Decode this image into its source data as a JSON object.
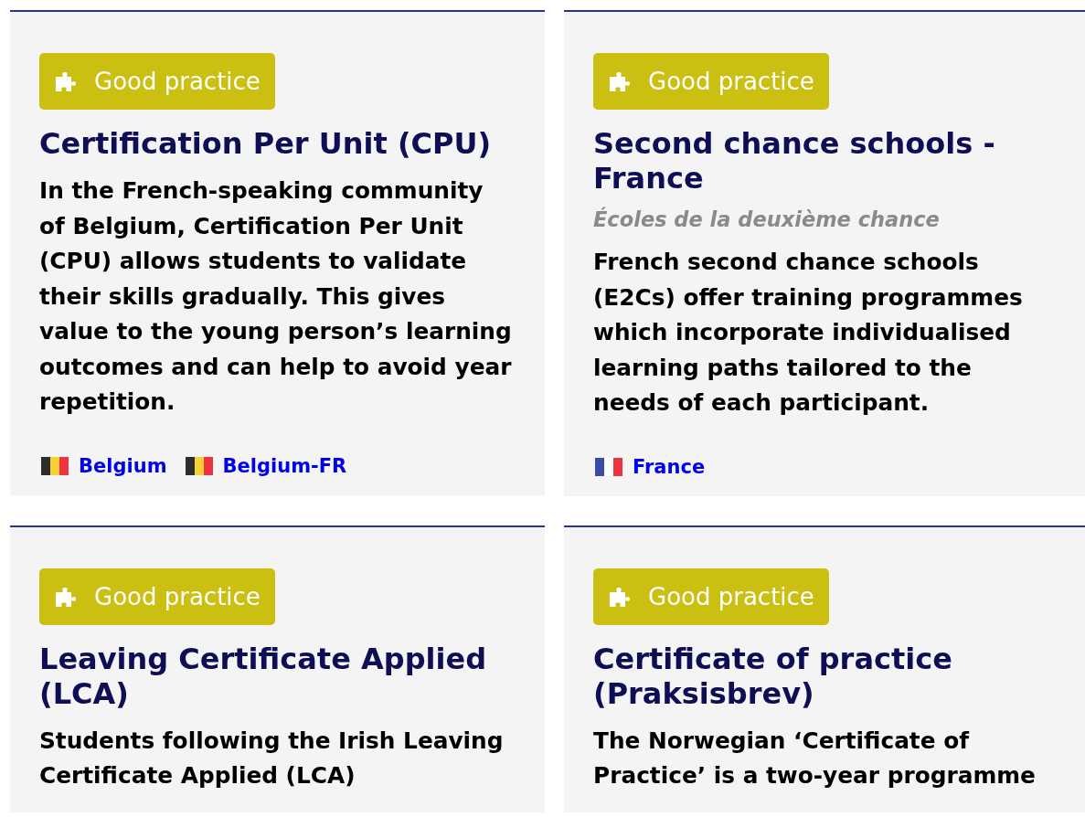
{
  "cards": [
    {
      "badge": "Good practice",
      "title": "Certification Per Unit (CPU)",
      "description": "In the French-speaking community of Belgium, Certification Per Unit (CPU) allows students to validate their skills gradually. This gives value to the young person’s learning outcomes and can help to avoid year repetition.",
      "countries": [
        {
          "name": "Belgium",
          "kind": "belgian"
        },
        {
          "name": "Belgium-FR",
          "kind": "belgian"
        }
      ]
    },
    {
      "badge": "Good practice",
      "title": "Second chance schools - France",
      "subtitle": "Écoles de la deuxième chance",
      "description": "French second chance schools (E2Cs) offer training programmes which incorporate individualised learning paths tailored to the needs of each participant.",
      "countries": [
        {
          "name": "France",
          "kind": "french"
        }
      ]
    },
    {
      "badge": "Good practice",
      "title": "Leaving Certificate Applied (LCA)",
      "description": "Students following the Irish Leaving Certificate Applied (LCA)"
    },
    {
      "badge": "Good practice",
      "title": "Certificate of practice (Praksisbrev)",
      "description": "The Norwegian ‘Certificate of Practice’ is a two-year programme"
    }
  ]
}
